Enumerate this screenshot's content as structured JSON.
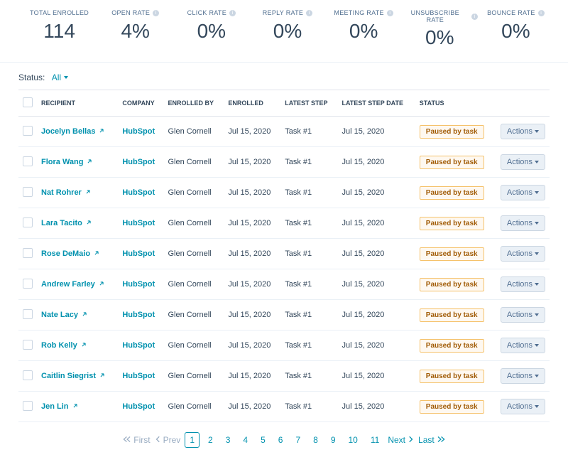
{
  "stats": [
    {
      "label": "TOTAL ENROLLED",
      "value": "114",
      "info": false
    },
    {
      "label": "OPEN RATE",
      "value": "4%",
      "info": true
    },
    {
      "label": "CLICK RATE",
      "value": "0%",
      "info": true
    },
    {
      "label": "REPLY RATE",
      "value": "0%",
      "info": true
    },
    {
      "label": "MEETING RATE",
      "value": "0%",
      "info": true
    },
    {
      "label": "UNSUBSCRIBE RATE",
      "value": "0%",
      "info": true
    },
    {
      "label": "BOUNCE RATE",
      "value": "0%",
      "info": true
    }
  ],
  "status_filter": {
    "label": "Status:",
    "value": "All"
  },
  "columns": [
    "RECIPIENT",
    "COMPANY",
    "ENROLLED BY",
    "ENROLLED",
    "LATEST STEP",
    "LATEST STEP DATE",
    "STATUS"
  ],
  "rows": [
    {
      "recipient": "Jocelyn Bellas",
      "company": "HubSpot",
      "enrolled_by": "Glen Cornell",
      "enrolled": "Jul 15, 2020",
      "latest_step": "Task #1",
      "latest_step_date": "Jul 15, 2020",
      "status": "Paused by task"
    },
    {
      "recipient": "Flora Wang",
      "company": "HubSpot",
      "enrolled_by": "Glen Cornell",
      "enrolled": "Jul 15, 2020",
      "latest_step": "Task #1",
      "latest_step_date": "Jul 15, 2020",
      "status": "Paused by task"
    },
    {
      "recipient": "Nat Rohrer",
      "company": "HubSpot",
      "enrolled_by": "Glen Cornell",
      "enrolled": "Jul 15, 2020",
      "latest_step": "Task #1",
      "latest_step_date": "Jul 15, 2020",
      "status": "Paused by task"
    },
    {
      "recipient": "Lara Tacito",
      "company": "HubSpot",
      "enrolled_by": "Glen Cornell",
      "enrolled": "Jul 15, 2020",
      "latest_step": "Task #1",
      "latest_step_date": "Jul 15, 2020",
      "status": "Paused by task"
    },
    {
      "recipient": "Rose DeMaio",
      "company": "HubSpot",
      "enrolled_by": "Glen Cornell",
      "enrolled": "Jul 15, 2020",
      "latest_step": "Task #1",
      "latest_step_date": "Jul 15, 2020",
      "status": "Paused by task"
    },
    {
      "recipient": "Andrew Farley",
      "company": "HubSpot",
      "enrolled_by": "Glen Cornell",
      "enrolled": "Jul 15, 2020",
      "latest_step": "Task #1",
      "latest_step_date": "Jul 15, 2020",
      "status": "Paused by task"
    },
    {
      "recipient": "Nate Lacy",
      "company": "HubSpot",
      "enrolled_by": "Glen Cornell",
      "enrolled": "Jul 15, 2020",
      "latest_step": "Task #1",
      "latest_step_date": "Jul 15, 2020",
      "status": "Paused by task"
    },
    {
      "recipient": "Rob Kelly",
      "company": "HubSpot",
      "enrolled_by": "Glen Cornell",
      "enrolled": "Jul 15, 2020",
      "latest_step": "Task #1",
      "latest_step_date": "Jul 15, 2020",
      "status": "Paused by task"
    },
    {
      "recipient": "Caitlin Siegrist",
      "company": "HubSpot",
      "enrolled_by": "Glen Cornell",
      "enrolled": "Jul 15, 2020",
      "latest_step": "Task #1",
      "latest_step_date": "Jul 15, 2020",
      "status": "Paused by task"
    },
    {
      "recipient": "Jen Lin",
      "company": "HubSpot",
      "enrolled_by": "Glen Cornell",
      "enrolled": "Jul 15, 2020",
      "latest_step": "Task #1",
      "latest_step_date": "Jul 15, 2020",
      "status": "Paused by task"
    }
  ],
  "actions_label": "Actions",
  "pagination": {
    "first": "First",
    "prev": "Prev",
    "next": "Next",
    "last": "Last",
    "pages": [
      "1",
      "2",
      "3",
      "4",
      "5",
      "6",
      "7",
      "8",
      "9",
      "10",
      "11"
    ],
    "current": "1"
  }
}
